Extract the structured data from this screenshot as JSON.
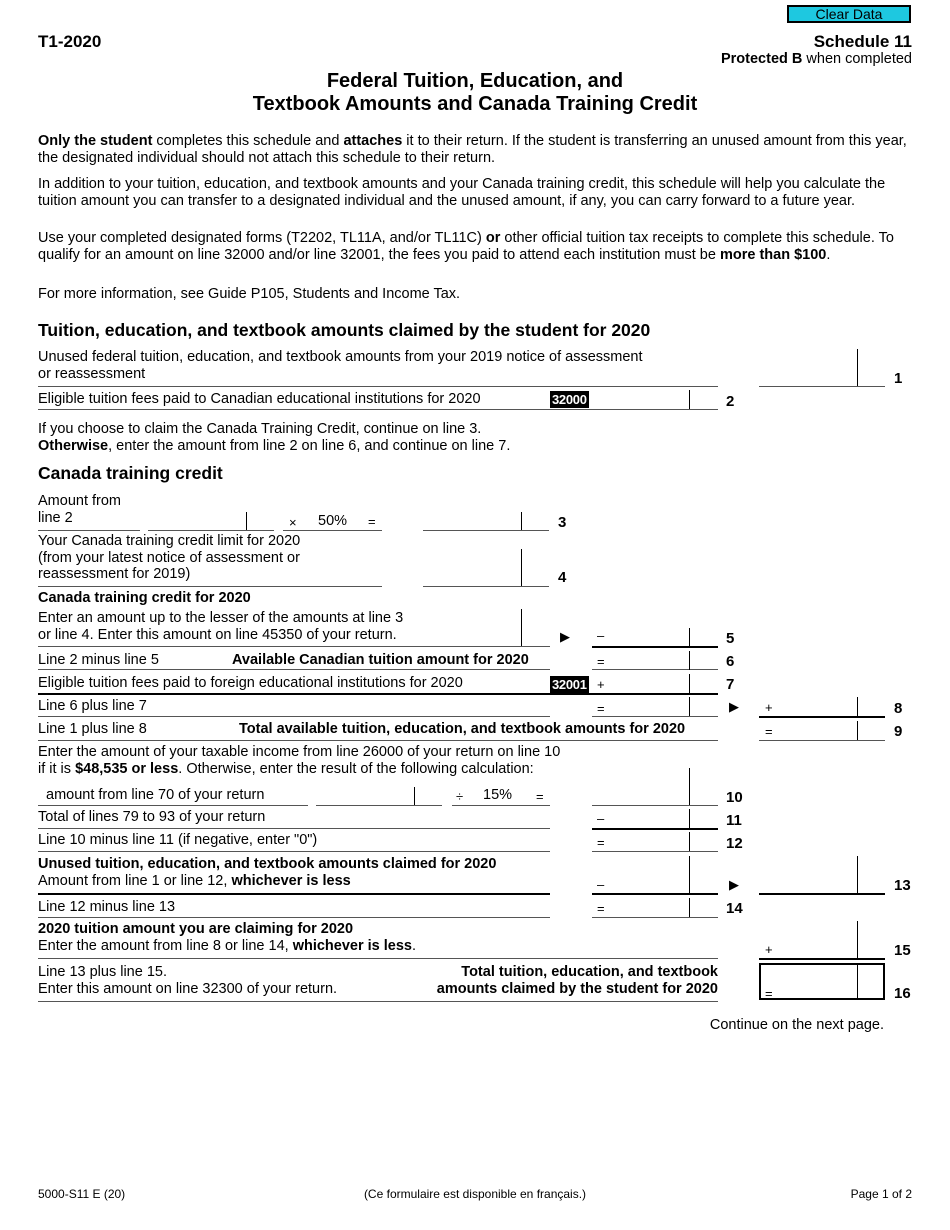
{
  "header": {
    "clear_button": "Clear Data",
    "form_id": "T1-2020",
    "schedule": "Schedule 11",
    "protected_bold": "Protected B",
    "protected_rest": " when completed",
    "title_line1": "Federal Tuition, Education, and",
    "title_line2": "Textbook Amounts and Canada Training Credit"
  },
  "intro": {
    "p1_b1": "Only the student",
    "p1_t1": " completes this schedule and ",
    "p1_b2": "attaches",
    "p1_t2": " it to their return. If the student is transferring an unused amount from this year, the designated individual should not attach this schedule to their return.",
    "p2": "In addition to your tuition, education, and textbook amounts and your Canada training credit, this schedule will help you calculate the tuition amount you can transfer to a designated individual and the unused amount, if any, you can carry forward to a future year.",
    "p3_t1": "Use your completed designated forms (T2202, TL11A, and/or TL11C) ",
    "p3_b1": "or",
    "p3_t2": " other official tuition tax receipts to complete this schedule. To qualify for an amount on line 32000 and/or line 32001, the fees you paid to attend each institution must be ",
    "p3_b2": "more than $100",
    "p3_t3": ".",
    "p4": "For more information, see Guide P105, Students and Income Tax."
  },
  "section1": {
    "heading": "Tuition, education, and textbook amounts claimed by the student for 2020",
    "line1_text_a": "Unused federal tuition, education, and textbook amounts from your 2019 notice of assessment",
    "line1_text_b": "or reassessment",
    "line1_num": "1",
    "line2_text": "Eligible tuition fees paid to Canadian educational institutions for 2020",
    "line2_code": "32000",
    "line2_num": "2",
    "note_a": "If you choose to claim the Canada Training Credit, continue on line 3.",
    "note_b_bold": "Otherwise",
    "note_b_rest": ", enter the amount from line 2 on line 6, and continue on line 7."
  },
  "section2": {
    "heading": "Canada training credit",
    "line3_label_a": "Amount from",
    "line3_label_b": "line 2",
    "line3_mult": "×",
    "line3_rate": "50%",
    "line3_eq": "=",
    "line3_num": "3",
    "line4_a": "Your Canada training credit limit for 2020",
    "line4_b": "(from your latest notice of assessment or",
    "line4_c": "reassessment for 2019)",
    "line4_num": "4",
    "line5_heading": "Canada training credit for 2020",
    "line5_a": "Enter an amount up to the lesser of the amounts at line 3",
    "line5_b": "or line 4. Enter this amount on line 45350 of your return.",
    "line5_op": "–",
    "line5_num": "5",
    "line6_text": "Line 2 minus line 5",
    "line6_bold": "Available Canadian tuition amount for 2020",
    "line6_op": "=",
    "line6_num": "6",
    "line7_text": "Eligible tuition fees paid to foreign educational institutions for 2020",
    "line7_code": "32001",
    "line7_op": "+",
    "line7_num": "7",
    "line8_text": "Line 6 plus line 7",
    "line8_op_left": "=",
    "line8_op_right": "+",
    "line8_num": "8",
    "line9_text": "Line 1 plus line 8",
    "line9_bold": "Total available tuition, education, and textbook amounts for 2020",
    "line9_op": "=",
    "line9_num": "9",
    "line10_a": "Enter the amount of your taxable income from line 26000 of your return on line 10",
    "line10_b_t1": "if it is ",
    "line10_b_bold": "$48,535 or less",
    "line10_b_t2": ". Otherwise, enter the result of the following calculation:",
    "line10_calc_label": "amount from line 70 of your return",
    "line10_div": "÷",
    "line10_rate": "15%",
    "line10_eq": "=",
    "line10_num": "10",
    "line11_text": "Total of lines 79 to 93 of your return",
    "line11_op": "–",
    "line11_num": "11",
    "line12_text": "Line 10 minus line 11 (if negative, enter \"0\")",
    "line12_op": "=",
    "line12_num": "12",
    "line13_bold": "Unused tuition, education, and textbook amounts claimed for 2020",
    "line13_t1": "Amount from line 1 or line 12, ",
    "line13_b2": "whichever is less",
    "line13_op": "–",
    "line13_num": "13",
    "line14_text": "Line 12 minus line 13",
    "line14_op": "=",
    "line14_num": "14",
    "line15_bold": "2020 tuition amount you are claiming for 2020",
    "line15_t1": "Enter the amount from line 8 or line 14, ",
    "line15_b2": "whichever is less",
    "line15_t2": ".",
    "line15_op": "+",
    "line15_num": "15",
    "line16_a": "Line 13 plus line 15.",
    "line16_b": "Enter this amount on line 32300 of your return.",
    "line16_bold_a": "Total tuition, education, and textbook",
    "line16_bold_b": "amounts claimed by the student for 2020",
    "line16_op": "=",
    "line16_num": "16",
    "continue": "Continue on the next page."
  },
  "footer": {
    "form_code": "5000-S11 E (20)",
    "french": "(Ce formulaire est disponible en français.)",
    "page": "Page 1 of 2"
  }
}
